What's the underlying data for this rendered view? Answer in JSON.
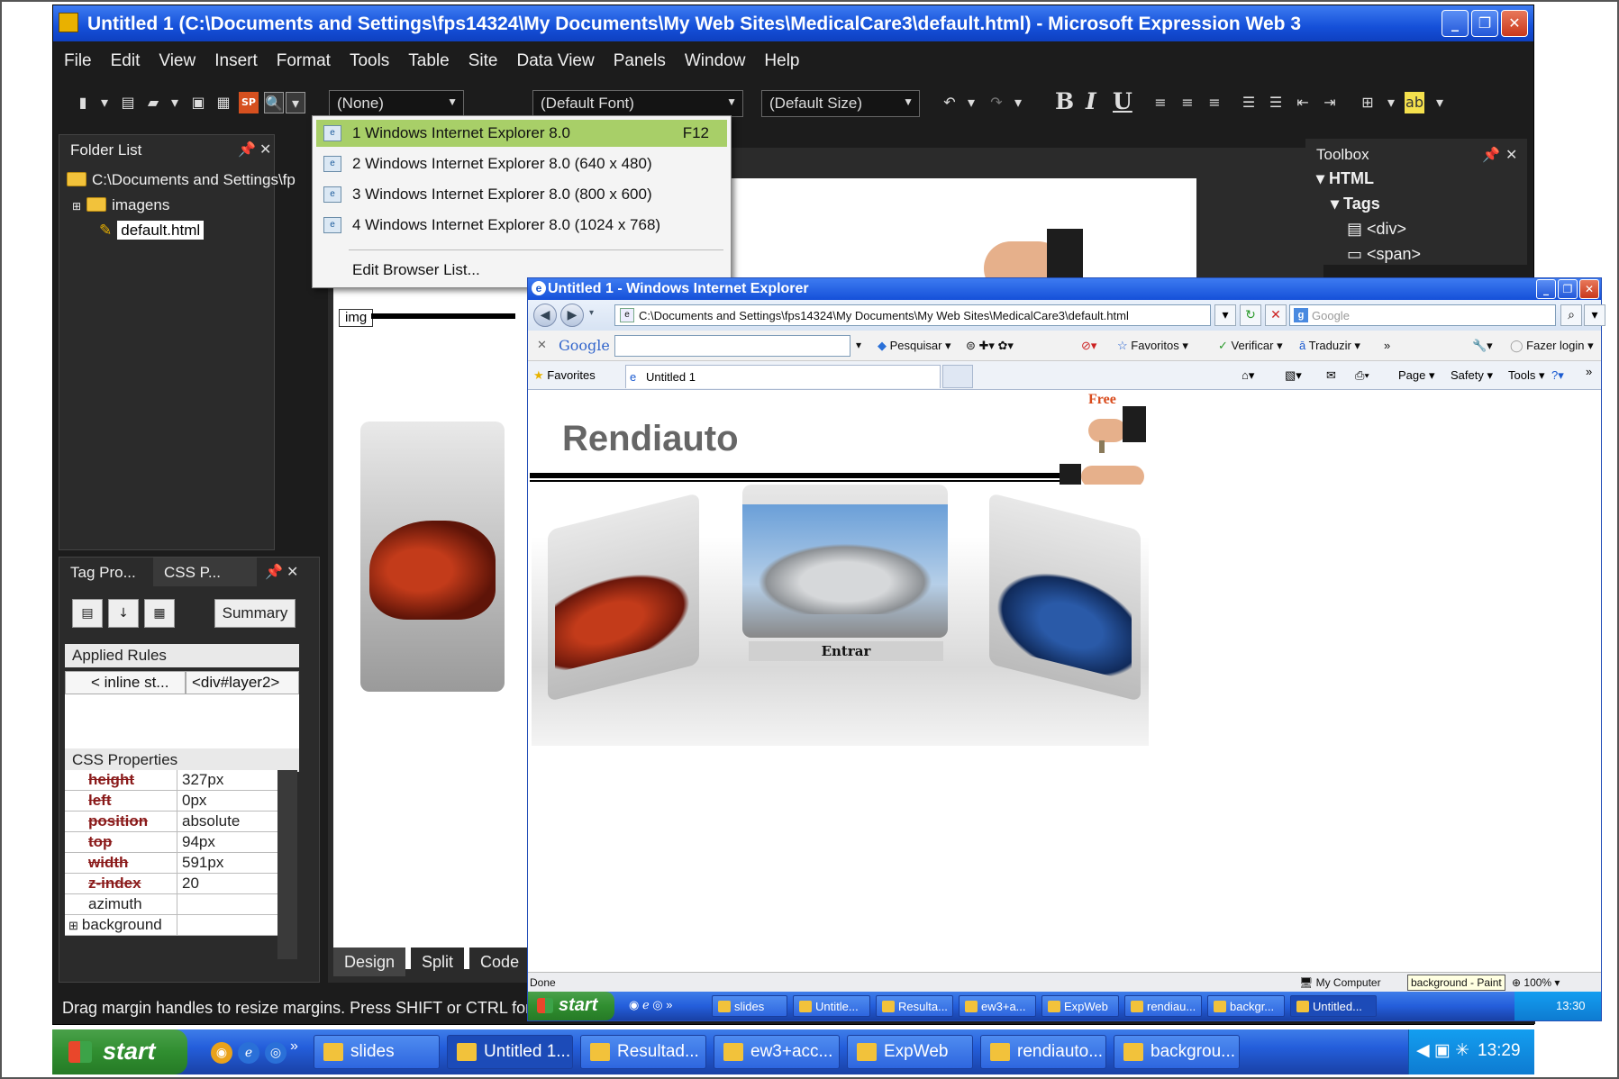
{
  "ew": {
    "title": "Untitled 1 (C:\\Documents and Settings\\fps14324\\My Documents\\My Web Sites\\MedicalCare3\\default.html) - Microsoft Expression Web 3",
    "menu": [
      "File",
      "Edit",
      "View",
      "Insert",
      "Format",
      "Tools",
      "Table",
      "Site",
      "Data View",
      "Panels",
      "Window",
      "Help"
    ],
    "toolbar": {
      "style_combo": "(None)",
      "font_combo": "(Default Font)",
      "size_combo": "(Default Size)",
      "bold": "B",
      "italic": "I",
      "underline": "U"
    },
    "folder_list": {
      "title": "Folder List",
      "root": "C:\\Documents and Settings\\fp",
      "items": [
        "imagens",
        "default.html"
      ]
    },
    "css_panel": {
      "tabs": [
        "Tag Pro...",
        "CSS P..."
      ],
      "summary_label": "Summary",
      "applied_rules_label": "Applied Rules",
      "rule_cells": [
        "< inline st...",
        "<div#layer2>"
      ],
      "css_properties_label": "CSS Properties",
      "properties": [
        {
          "name": "height",
          "value": "327px",
          "strike": true
        },
        {
          "name": "left",
          "value": "0px",
          "strike": true
        },
        {
          "name": "position",
          "value": "absolute",
          "strike": true
        },
        {
          "name": "top",
          "value": "94px",
          "strike": true
        },
        {
          "name": "width",
          "value": "591px",
          "strike": true
        },
        {
          "name": "z-index",
          "value": "20",
          "strike": true
        },
        {
          "name": "azimuth",
          "value": "",
          "strike": false
        },
        {
          "name": "background",
          "value": "",
          "strike": false
        }
      ]
    },
    "editor": {
      "img_tag": "img",
      "view_tabs": [
        "Design",
        "Split",
        "Code"
      ]
    },
    "toolbox": {
      "title": "Toolbox",
      "html": "HTML",
      "tags": "Tags",
      "items": [
        "<div>",
        "<span>"
      ]
    },
    "preview_menu": {
      "items": [
        {
          "label": "1 Windows Internet Explorer 8.0",
          "shortcut": "F12"
        },
        {
          "label": "2 Windows Internet Explorer 8.0 (640 x 480)",
          "shortcut": ""
        },
        {
          "label": "3 Windows Internet Explorer 8.0 (800 x 600)",
          "shortcut": ""
        },
        {
          "label": "4 Windows Internet Explorer 8.0 (1024 x 768)",
          "shortcut": ""
        }
      ],
      "edit_list": "Edit Browser List..."
    },
    "status": "Drag margin handles to resize margins. Press SHIFT or CTRL for"
  },
  "ie": {
    "title": "Untitled 1 - Windows Internet Explorer",
    "address": "C:\\Documents and Settings\\fps14324\\My Documents\\My Web Sites\\MedicalCare3\\default.html",
    "search_placeholder": "Google",
    "google_bar": {
      "logo": "Google",
      "search": "Pesquisar",
      "favorites": "Favoritos",
      "check": "Verificar",
      "translate": "Traduzir",
      "login": "Fazer login"
    },
    "favorites_label": "Favorites",
    "tab_label": "Untitled 1",
    "command_bar": [
      "Page",
      "Safety",
      "Tools"
    ],
    "site": {
      "title": "Rendiauto",
      "enter": "Entrar",
      "badge": "Free"
    },
    "status_left": "Done",
    "status_zone": "My Computer",
    "status_tooltip": "background - Paint",
    "zoom": "100%",
    "taskbar": {
      "start": "start",
      "items": [
        "slides",
        "Untitle...",
        "Resulta...",
        "ew3+a...",
        "ExpWeb",
        "rendiau...",
        "backgr...",
        "Untitled..."
      ],
      "clock": "13:30"
    }
  },
  "taskbar": {
    "start": "start",
    "items": [
      "slides",
      "Untitled 1...",
      "Resultad...",
      "ew3+acc...",
      "ExpWeb",
      "rendiauto...",
      "backgrou..."
    ],
    "clock": "13:29"
  }
}
